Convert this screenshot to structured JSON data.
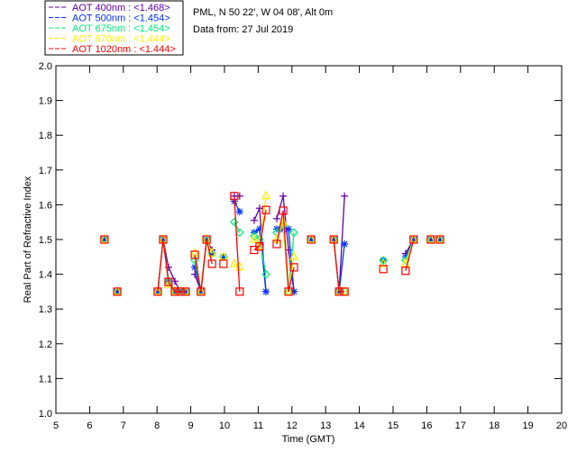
{
  "header": {
    "site": "PML, N 50 22', W 04 08', Alt 0m",
    "date": "Data from: 27 Jul 2019"
  },
  "legend": [
    {
      "label": "AOT  400nm : <1.468>",
      "color": "#6600aa",
      "marker": "plus"
    },
    {
      "label": "AOT  500nm : <1.454>",
      "color": "#0033ff",
      "marker": "asterisk"
    },
    {
      "label": "AOT  675nm : <1.454>",
      "color": "#00ee77",
      "marker": "diamond"
    },
    {
      "label": "AOT  870nm : <1.444>",
      "color": "#ffee00",
      "marker": "triangle"
    },
    {
      "label": "AOT 1020nm : <1.444>",
      "color": "#ff0000",
      "marker": "square"
    }
  ],
  "chart_data": {
    "type": "scatter",
    "xlabel": "Time (GMT)",
    "ylabel": "Real Part of Refractive Index",
    "xlim": [
      5,
      20
    ],
    "ylim": [
      1.0,
      2.0
    ],
    "xticks": [
      "5",
      "6",
      "7",
      "8",
      "9",
      "10",
      "11",
      "12",
      "13",
      "14",
      "15",
      "16",
      "17",
      "18",
      "19",
      "20"
    ],
    "yticks": [
      "1.0",
      "1.1",
      "1.2",
      "1.3",
      "1.4",
      "1.5",
      "1.6",
      "1.7",
      "1.8",
      "1.9",
      "2.0"
    ],
    "grid": false,
    "legend_placement": "top-left-outside",
    "x": [
      6.44,
      6.82,
      8.02,
      8.18,
      8.34,
      8.53,
      8.69,
      8.85,
      9.12,
      9.3,
      9.47,
      9.63,
      9.97,
      10.29,
      10.45,
      10.88,
      11.04,
      11.23,
      11.55,
      11.74,
      11.9,
      12.06,
      12.57,
      13.24,
      13.4,
      13.56,
      14.71,
      15.37,
      15.61,
      16.12,
      16.39
    ],
    "series": [
      {
        "name": "AOT  400nm",
        "values": [
          1.5,
          1.35,
          1.35,
          1.5,
          1.42,
          1.38,
          1.35,
          1.35,
          1.4,
          1.35,
          1.5,
          1.47,
          1.45,
          1.625,
          1.625,
          1.555,
          1.59,
          1.35,
          1.56,
          1.625,
          1.47,
          1.35,
          1.5,
          1.5,
          1.35,
          1.625,
          1.44,
          1.46,
          1.5,
          1.5,
          1.5
        ]
      },
      {
        "name": "AOT  500nm",
        "values": [
          1.5,
          1.35,
          1.35,
          1.5,
          1.38,
          1.35,
          1.35,
          1.35,
          1.42,
          1.35,
          1.5,
          1.46,
          1.45,
          1.61,
          1.58,
          1.52,
          1.53,
          1.35,
          1.53,
          1.53,
          1.53,
          1.35,
          1.5,
          1.5,
          1.35,
          1.487,
          1.44,
          1.45,
          1.5,
          1.5,
          1.5
        ]
      },
      {
        "name": "AOT  675nm",
        "values": [
          1.5,
          1.35,
          1.35,
          1.5,
          1.38,
          1.35,
          1.35,
          1.35,
          1.44,
          1.35,
          1.5,
          1.46,
          1.45,
          1.55,
          1.52,
          1.51,
          1.5,
          1.4,
          1.52,
          1.54,
          1.35,
          1.52,
          1.5,
          1.5,
          1.35,
          1.35,
          1.44,
          1.44,
          1.5,
          1.5,
          1.5
        ]
      },
      {
        "name": "AOT  870nm",
        "values": [
          1.5,
          1.35,
          1.35,
          1.5,
          1.37,
          1.35,
          1.35,
          1.35,
          1.46,
          1.35,
          1.5,
          1.46,
          1.45,
          1.43,
          1.42,
          1.5,
          1.48,
          1.625,
          1.5,
          1.55,
          1.35,
          1.45,
          1.5,
          1.5,
          1.35,
          1.35,
          1.43,
          1.43,
          1.5,
          1.5,
          1.5
        ]
      },
      {
        "name": "AOT 1020nm",
        "values": [
          1.5,
          1.35,
          1.35,
          1.5,
          1.378,
          1.35,
          1.35,
          1.35,
          1.456,
          1.35,
          1.5,
          1.43,
          1.43,
          1.625,
          1.35,
          1.47,
          1.48,
          1.585,
          1.487,
          1.583,
          1.35,
          1.42,
          1.5,
          1.5,
          1.35,
          1.35,
          1.415,
          1.41,
          1.5,
          1.5,
          1.5
        ]
      }
    ]
  }
}
